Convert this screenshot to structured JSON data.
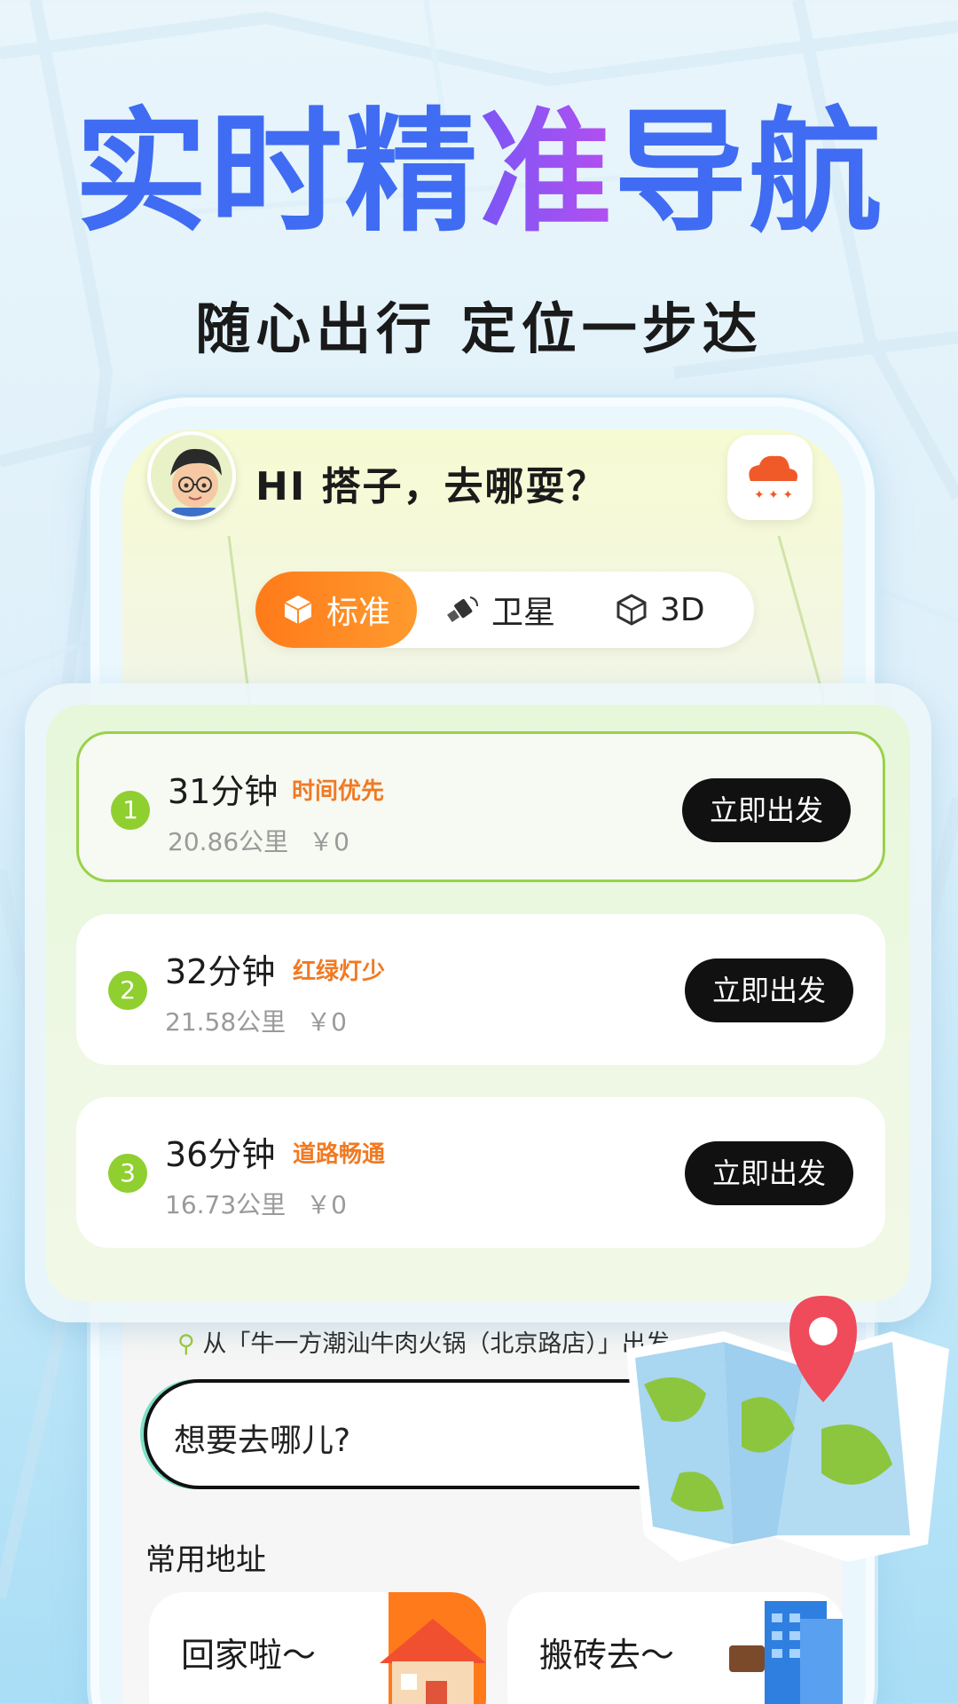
{
  "headline": {
    "part1": "实时精",
    "accent": "准",
    "part2": "导航",
    "subtitle": "随心出行 定位一步达"
  },
  "app": {
    "greeting": "HI 搭子，去哪耍？",
    "weather_icon": "snow-cloud-icon",
    "map_modes": [
      {
        "label": "标准",
        "icon": "cube-icon",
        "active": true
      },
      {
        "label": "卫星",
        "icon": "satellite-icon",
        "active": false
      },
      {
        "label": "3D",
        "icon": "box-3d-icon",
        "active": false
      }
    ],
    "routes": [
      {
        "num": "1",
        "time": "31分钟",
        "tag": "时间优先",
        "distance": "20.86公里",
        "cost": "￥0",
        "button": "立即出发"
      },
      {
        "num": "2",
        "time": "32分钟",
        "tag": "红绿灯少",
        "distance": "21.58公里",
        "cost": "￥0",
        "button": "立即出发"
      },
      {
        "num": "3",
        "time": "36分钟",
        "tag": "道路畅通",
        "distance": "16.73公里",
        "cost": "￥0",
        "button": "立即出发"
      }
    ],
    "origin": "从「牛一方潮汕牛肉火锅（北京路店）」出发",
    "search_placeholder": "想要去哪儿?",
    "common_title": "常用地址",
    "common_addresses": [
      {
        "label": "回家啦～",
        "icon": "house-icon"
      },
      {
        "label": "搬砖去～",
        "icon": "briefcase-icon"
      }
    ]
  },
  "colors": {
    "headline_blue": "#3f6cf2",
    "headline_purple": "#9a52f3",
    "orange": "#ff7a1a",
    "green": "#8fcf2f",
    "button_black": "#111111"
  }
}
